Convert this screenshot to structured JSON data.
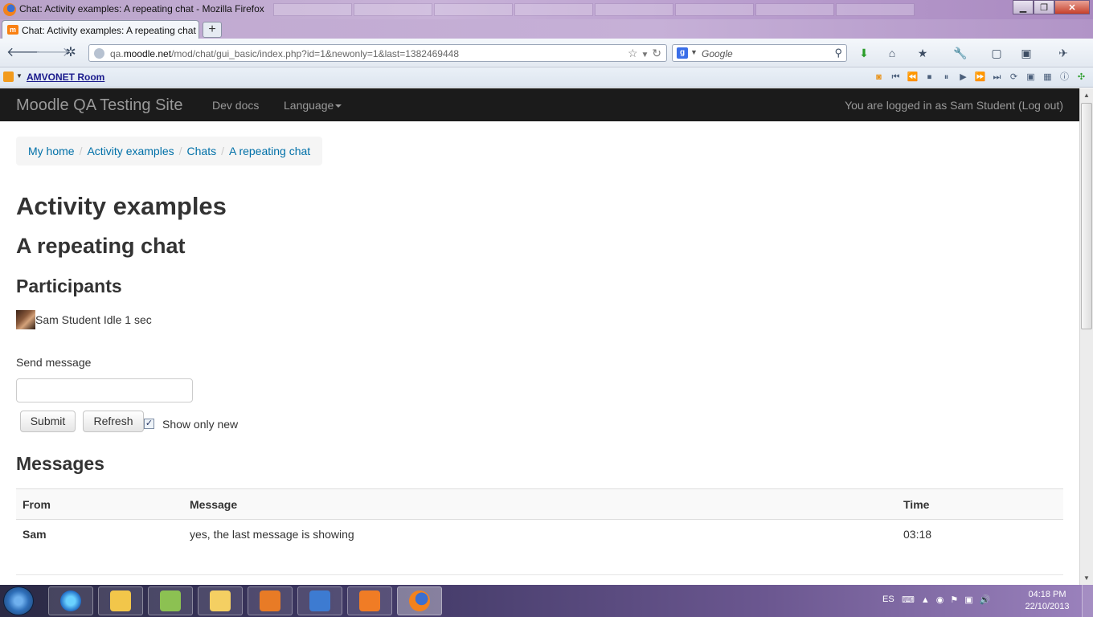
{
  "window": {
    "title": "Chat: Activity examples: A repeating chat - Mozilla Firefox",
    "minimize": "▁",
    "maximize": "❐",
    "close": "✕"
  },
  "tabs": [
    {
      "title": "Chat: Activity examples: A repeating chat",
      "favicon": "m",
      "active": true
    }
  ],
  "new_tab_label": "+",
  "navigation": {
    "back": "🡐",
    "forward": "🡒",
    "url_prefix": "qa.",
    "url_domain": "moodle.net",
    "url_path": "/mod/chat/gui_basic/index.php?id=1&newonly=1&last=1382469448",
    "star_icon": "☆",
    "reload_icon": "↻",
    "search_engine": "g",
    "search_placeholder": "Google",
    "search_icon": "⚲",
    "toolbar_icons": [
      "⬇",
      "⌂",
      "★",
      "🔧",
      "▢",
      "▣",
      "✈"
    ]
  },
  "bookmarks": {
    "items": [
      "AMVONET Room"
    ]
  },
  "moodle": {
    "site_name": "Moodle QA Testing Site",
    "nav_links": [
      "Dev docs",
      "Language"
    ],
    "login_info": "You are logged in as Sam Student (Log out)"
  },
  "breadcrumb": [
    "My home",
    "Activity examples",
    "Chats",
    "A repeating chat"
  ],
  "headings": {
    "course": "Activity examples",
    "chat": "A repeating chat",
    "participants": "Participants",
    "messages": "Messages"
  },
  "participant": {
    "name": "Sam Student",
    "status": "Idle 1 sec"
  },
  "form": {
    "send_label": "Send message",
    "message_value": "",
    "submit_label": "Submit",
    "refresh_label": "Refresh",
    "show_only_new_label": "Show only new",
    "show_only_new_checked": true
  },
  "messages_table": {
    "columns": [
      "From",
      "Message",
      "Time"
    ],
    "rows": [
      {
        "from": "Sam",
        "message": "yes, the last message is showing",
        "time": "03:18"
      }
    ]
  },
  "taskbar": {
    "language": "ES",
    "time": "04:18 PM",
    "date": "22/10/2013"
  }
}
